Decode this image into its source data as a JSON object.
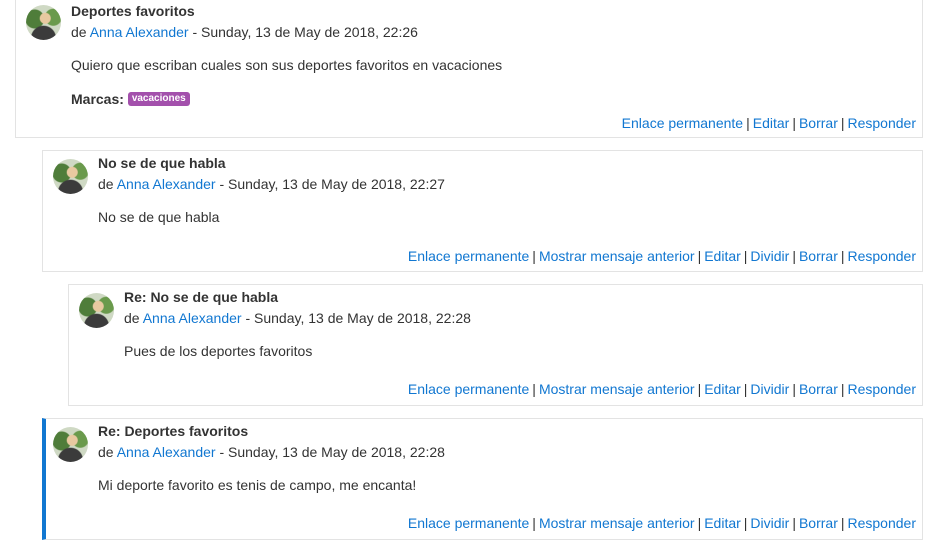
{
  "posts": [
    {
      "subject": "Deportes favoritos",
      "by_prefix": "de",
      "author": "Anna Alexander",
      "date": "- Sunday, 13 de May de 2018, 22:26",
      "content": "Quiero que escriban cuales son sus deportes favoritos en vacaciones",
      "tags_label": "Marcas:",
      "tag": "vacaciones",
      "links": [
        "Enlace permanente",
        "Editar",
        "Borrar",
        "Responder"
      ]
    },
    {
      "subject": "No se de que habla",
      "by_prefix": "de",
      "author": "Anna Alexander",
      "date": "- Sunday, 13 de May de 2018, 22:27",
      "content": "No se de que habla",
      "links": [
        "Enlace permanente",
        "Mostrar mensaje anterior",
        "Editar",
        "Dividir",
        "Borrar",
        "Responder"
      ]
    },
    {
      "subject": "Re: No se de que habla",
      "by_prefix": "de",
      "author": "Anna Alexander",
      "date": "- Sunday, 13 de May de 2018, 22:28",
      "content": "Pues de los deportes favoritos",
      "links": [
        "Enlace permanente",
        "Mostrar mensaje anterior",
        "Editar",
        "Dividir",
        "Borrar",
        "Responder"
      ]
    },
    {
      "subject": "Re: Deportes favoritos",
      "by_prefix": "de",
      "author": "Anna Alexander",
      "date": "- Sunday, 13 de May de 2018, 22:28",
      "content": "Mi deporte favorito es tenis de campo, me encanta!",
      "links": [
        "Enlace permanente",
        "Mostrar mensaje anterior",
        "Editar",
        "Dividir",
        "Borrar",
        "Responder"
      ]
    }
  ],
  "colors": {
    "link": "#1177d1",
    "tag_bg": "#a350ac",
    "focus_border": "#1177d1"
  }
}
